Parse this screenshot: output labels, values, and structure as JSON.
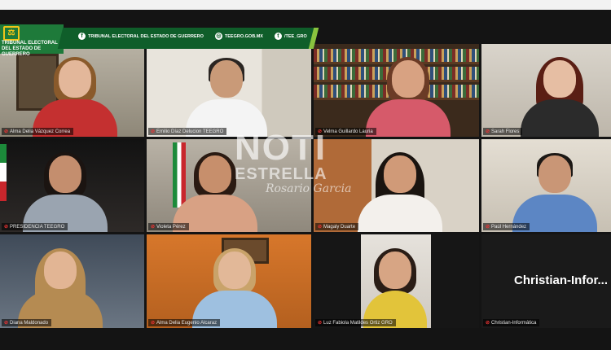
{
  "banner": {
    "org_line1": "TRIBUNAL ELECTORAL",
    "org_line2": "DEL ESTADO DE GUERRERO",
    "facebook": "TRIBUNAL ELECTORAL DEL ESTADO DE GUERRERO",
    "web": "TEEGRO.GOB.MX",
    "twitter": "/TEE_GRO"
  },
  "watermark": {
    "line1": "NOTI",
    "line2": "ESTRELLA",
    "line3": "Rosario Garcia"
  },
  "participants": [
    {
      "name": "Alma Delia Vázquez Correa"
    },
    {
      "name": "Emilio Díaz Delucion TEEGRO"
    },
    {
      "name": "Velma Guillardo Lauria"
    },
    {
      "name": "Sarah Flores"
    },
    {
      "name": "PRESIDENCIA TEEGRO"
    },
    {
      "name": "Violeta Pérez"
    },
    {
      "name": "Magaly Duarte"
    },
    {
      "name": "Paúl Hernández"
    },
    {
      "name": "Diana Maldonado"
    },
    {
      "name": "Alma Delia Eugenio Alcaraz"
    },
    {
      "name": "Luz Fabiola Matildes Ortiz GRO"
    },
    {
      "name": "Christian-Informática"
    }
  ],
  "christian_tile_text": "Christian-Infor...",
  "colors": {
    "active_speaker": "#9be23a",
    "banner_green": "#0f5e2a",
    "mic_muted": "#e33333"
  }
}
